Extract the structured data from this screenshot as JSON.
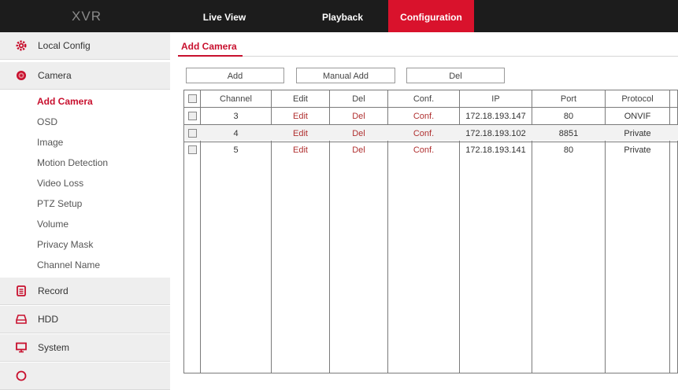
{
  "header": {
    "brand": "XVR",
    "tabs": [
      "Live View",
      "Playback",
      "Configuration"
    ],
    "active_tab": "Configuration",
    "accent_color": "#d9122c"
  },
  "sidebar": {
    "items": [
      {
        "label": "Local Config",
        "icon": "gear-icon"
      },
      {
        "label": "Camera",
        "icon": "camera-icon"
      },
      {
        "label": "Record",
        "icon": "record-icon"
      },
      {
        "label": "HDD",
        "icon": "hdd-icon"
      },
      {
        "label": "System",
        "icon": "monitor-icon"
      }
    ],
    "camera_submenu": [
      "Add Camera",
      "OSD",
      "Image",
      "Motion Detection",
      "Video Loss",
      "PTZ Setup",
      "Volume",
      "Privacy Mask",
      "Channel Name"
    ],
    "active_submenu": "Add Camera"
  },
  "main": {
    "title": "Add Camera",
    "buttons": {
      "add": "Add",
      "manual_add": "Manual Add",
      "del": "Del"
    },
    "table": {
      "columns": [
        "Channel",
        "Edit",
        "Del",
        "Conf.",
        "IP",
        "Port",
        "Protocol"
      ],
      "rows": [
        {
          "channel": "3",
          "edit": "Edit",
          "del": "Del",
          "conf": "Conf.",
          "ip": "172.18.193.147",
          "port": "80",
          "protocol": "ONVIF"
        },
        {
          "channel": "4",
          "edit": "Edit",
          "del": "Del",
          "conf": "Conf.",
          "ip": "172.18.193.102",
          "port": "8851",
          "protocol": "Private"
        },
        {
          "channel": "5",
          "edit": "Edit",
          "del": "Del",
          "conf": "Conf.",
          "ip": "172.18.193.141",
          "port": "80",
          "protocol": "Private"
        }
      ]
    }
  }
}
